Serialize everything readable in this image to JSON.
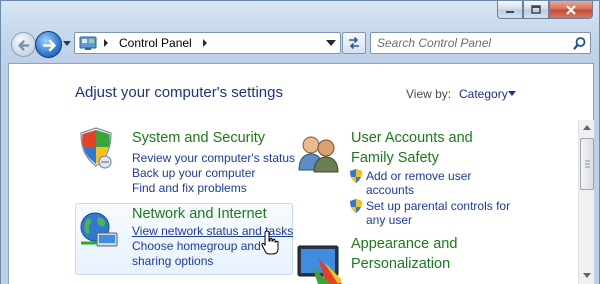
{
  "window": {
    "minimize_icon": "minimize-icon",
    "maximize_icon": "maximize-icon",
    "close_icon": "close-icon"
  },
  "address_bar": {
    "location": "Control Panel"
  },
  "search": {
    "placeholder": "Search Control Panel"
  },
  "page_title": "Adjust your computer's settings",
  "view_by": {
    "label": "View by:",
    "value": "Category"
  },
  "categories": [
    {
      "title": "System and Security",
      "links": [
        "Review your computer's status",
        "Back up your computer",
        "Find and fix problems"
      ]
    },
    {
      "title": "Network and Internet",
      "links": [
        "View network status and tasks",
        "Choose homegroup and",
        "sharing options"
      ]
    },
    {
      "title_line1": "User Accounts and",
      "title_line2": "Family Safety",
      "links": [
        "Add or remove user",
        "accounts",
        "Set up parental controls for",
        "any user"
      ]
    },
    {
      "title_line1": "Appearance and",
      "title_line2": "Personalization"
    }
  ],
  "colors": {
    "category_title": "#1c7a19",
    "link": "#1e3b9c",
    "page_title": "#1e3287"
  }
}
